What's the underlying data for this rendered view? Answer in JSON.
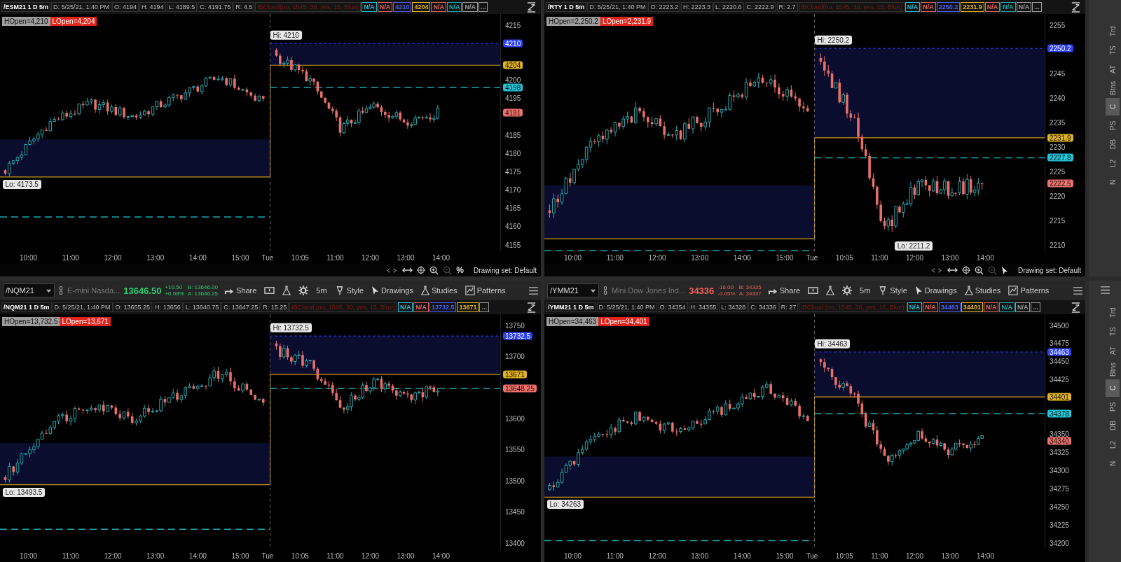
{
  "rows": [
    {
      "panels": [
        {
          "header": {
            "symbol": "/ESM21 1 D 5m",
            "fields": [
              "D: 5/25/21, 1:40 PM",
              "O: 4194",
              "H: 4194",
              "L: 4189.5",
              "C: 4191.75",
              "R: 4.5"
            ],
            "study": "IBCloud(no, 1545, 30, yes, 15, Blue)",
            "values": [
              {
                "text": "N/A",
                "color": "#22b8cf"
              },
              {
                "text": "N/A",
                "color": "#e0605a"
              },
              {
                "text": "4210",
                "color": "#4a5cff"
              },
              {
                "text": "4204",
                "color": "#e0b21d"
              },
              {
                "text": "N/A",
                "color": "#e0605a"
              },
              {
                "text": "N/A",
                "color": "#1aa6a6"
              },
              {
                "text": "N/A",
                "color": "#9a9a9a"
              },
              {
                "text": "...",
                "color": "#9a9a9a"
              }
            ]
          },
          "badges": [
            {
              "text": "HOpen=4,210",
              "color": "#9e9e9e"
            },
            {
              "text": "LOpen=4,204",
              "color": "#e0241b"
            }
          ],
          "y_ticks": [
            "4215",
            "4200",
            "4195",
            "4185",
            "4180",
            "4175",
            "4170",
            "4165",
            "4160",
            "4155"
          ],
          "price_tags": [
            {
              "text": "4210",
              "color": "#2b3ff5"
            },
            {
              "text": "4204",
              "color": "#e0b21d"
            },
            {
              "text": "4198",
              "color": "#1ec8dc"
            },
            {
              "text": "4191",
              "color": "#f0716b"
            }
          ],
          "sessions": [
            {
              "lo_label": "Lo: 4173.5",
              "x_ticks": [
                "10:00",
                "11:00",
                "12:00",
                "13:00",
                "14:00",
                "15:00"
              ]
            },
            {
              "hi_label": "Hi: 4210",
              "x_ticks": [
                "Tue",
                "10:05",
                "11:00",
                "12:00",
                "13:00",
                "14:00"
              ]
            }
          ],
          "footer": {
            "tool": {
              "kind": "text",
              "label": "%"
            },
            "drawing_set": "Drawing set: Default"
          }
        },
        {
          "header": {
            "symbol": "/RTY 1 D 5m",
            "fields": [
              "D: 5/25/21, 1:40 PM",
              "O: 2223.2",
              "H: 2223.3",
              "L: 2220.6",
              "C: 2222.9",
              "R: 2.7"
            ],
            "study": "IBCloud(no, 1545, 30, yes, 15, Blue)",
            "values": [
              {
                "text": "N/A",
                "color": "#22b8cf"
              },
              {
                "text": "N/A",
                "color": "#e0605a"
              },
              {
                "text": "2250.2",
                "color": "#4a5cff"
              },
              {
                "text": "2231.9",
                "color": "#e0b21d"
              },
              {
                "text": "N/A",
                "color": "#e0605a"
              },
              {
                "text": "N/A",
                "color": "#1aa6a6"
              },
              {
                "text": "N/A",
                "color": "#9a9a9a"
              },
              {
                "text": "...",
                "color": "#9a9a9a"
              }
            ]
          },
          "badges": [
            {
              "text": "HOpen=2,250.2",
              "color": "#9e9e9e"
            },
            {
              "text": "LOpen=2,231.9",
              "color": "#e0241b"
            }
          ],
          "y_ticks": [
            "2255",
            "2245",
            "2240",
            "2235",
            "2230",
            "2225",
            "2220",
            "2215",
            "2210"
          ],
          "price_tags": [
            {
              "text": "2250.2",
              "color": "#2b3ff5"
            },
            {
              "text": "2231.9",
              "color": "#e0b21d"
            },
            {
              "text": "2227.8",
              "color": "#1ec8dc"
            },
            {
              "text": "2222.5",
              "color": "#f0716b"
            }
          ],
          "sessions": [
            {
              "x_ticks": [
                "10:00",
                "11:00",
                "12:00",
                "13:00",
                "14:00",
                "15:00"
              ]
            },
            {
              "hi_label": "Hi: 2250.2",
              "lo_label": "Lo: 2211.2",
              "x_ticks": [
                "Tue",
                "10:05",
                "11:00",
                "12:00",
                "13:00",
                "14:00"
              ]
            }
          ],
          "footer": {
            "tool": {
              "kind": "pointer"
            },
            "drawing_set": "Drawing set: Default"
          }
        }
      ],
      "sidebar": {
        "tabs": [
          {
            "label": "Trd",
            "selected": false
          },
          {
            "label": "TS",
            "selected": false
          },
          {
            "label": "AT",
            "selected": false
          },
          {
            "label": "Btns",
            "selected": false
          },
          {
            "label": "C",
            "selected": true
          },
          {
            "label": "PS",
            "selected": false
          },
          {
            "label": "DB",
            "selected": false
          },
          {
            "label": "L2",
            "selected": false
          },
          {
            "label": "N",
            "selected": false
          }
        ]
      }
    },
    {
      "panels": [
        {
          "toolbar": {
            "symbol": "/NQM21",
            "description": "E-mini Nasda...",
            "price": "13646.50",
            "change": [
              "+10.50",
              "+0.08%"
            ],
            "quote": [
              "B: 13646.00",
              "A: 13646.25"
            ],
            "buttons": [
              {
                "kind": "share",
                "label": "Share"
              },
              {
                "kind": "alert"
              },
              {
                "kind": "flask"
              },
              {
                "kind": "gear"
              },
              {
                "kind": "text",
                "label": "5m"
              },
              {
                "kind": "style",
                "label": "Style"
              },
              {
                "kind": "pointer",
                "label": "Drawings"
              },
              {
                "kind": "flask",
                "label": "Studies"
              },
              {
                "kind": "pattern",
                "label": "Patterns"
              }
            ]
          },
          "header": {
            "symbol": "/NQM21 1 D 5m",
            "fields": [
              "D: 5/25/21, 1:40 PM",
              "O: 13655.25",
              "H: 13656",
              "L: 13640.75",
              "C: 13647.25",
              "R: 15.25"
            ],
            "study": "IBCloud (no, 1545, 30, yes, 15, Blue)",
            "values": [
              {
                "text": "N/A",
                "color": "#22b8cf"
              },
              {
                "text": "N/A",
                "color": "#e0605a"
              },
              {
                "text": "13732.5",
                "color": "#4a5cff"
              },
              {
                "text": "13671",
                "color": "#e0b21d"
              },
              {
                "text": "...",
                "color": "#9a9a9a"
              }
            ]
          },
          "badges": [
            {
              "text": "HOpen=13,732.5",
              "color": "#9e9e9e"
            },
            {
              "text": "LOpen=13,671",
              "color": "#e0241b"
            }
          ],
          "y_ticks": [
            "13750",
            "13700",
            "13600",
            "13550",
            "13500",
            "13450",
            "13400"
          ],
          "price_tags": [
            {
              "text": "13732.5",
              "color": "#2b3ff5"
            },
            {
              "text": "13671",
              "color": "#e0b21d"
            },
            {
              "text": "13648.25",
              "color": "#f0716b"
            }
          ],
          "sessions": [
            {
              "lo_label": "Lo: 13493.5",
              "x_ticks": [
                "10:00",
                "11:00",
                "12:00",
                "13:00",
                "14:00",
                "15:00"
              ]
            },
            {
              "hi_label": "Hi: 13732.5",
              "x_ticks": [
                "Tue",
                "10:05",
                "11:00",
                "12:00",
                "13:00",
                "14:00"
              ]
            }
          ]
        },
        {
          "toolbar": {
            "symbol": "/YMM21",
            "description": "Mini Dow Jones Ind...",
            "price": "34336",
            "change": [
              "-16.00",
              "-0.05%"
            ],
            "quote": [
              "B: 34335",
              "A: 34337"
            ],
            "buttons": [
              {
                "kind": "share",
                "label": "Share"
              },
              {
                "kind": "alert"
              },
              {
                "kind": "flask"
              },
              {
                "kind": "gear"
              },
              {
                "kind": "text",
                "label": "5m"
              },
              {
                "kind": "style",
                "label": "Style"
              },
              {
                "kind": "pointer",
                "label": "Drawings"
              },
              {
                "kind": "flask",
                "label": "Studies"
              },
              {
                "kind": "pattern",
                "label": "Patterns"
              }
            ]
          },
          "header": {
            "symbol": "/YMM21 1 D 5m",
            "fields": [
              "D: 5/25/21, 1:40 PM",
              "O: 34354",
              "H: 34355",
              "L: 34328",
              "C: 34336",
              "R: 27"
            ],
            "study": "IBCloud (no, 1545, 30, yes, 15, Blue)",
            "values": [
              {
                "text": "N/A",
                "color": "#22b8cf"
              },
              {
                "text": "N/A",
                "color": "#e0605a"
              },
              {
                "text": "34463",
                "color": "#4a5cff"
              },
              {
                "text": "34401",
                "color": "#e0b21d"
              },
              {
                "text": "N/A",
                "color": "#e0605a"
              },
              {
                "text": "N/A",
                "color": "#1aa6a6"
              },
              {
                "text": "N/A",
                "color": "#9a9a9a"
              },
              {
                "text": "...",
                "color": "#9a9a9a"
              }
            ]
          },
          "badges": [
            {
              "text": "HOpen=34,463",
              "color": "#9e9e9e"
            },
            {
              "text": "LOpen=34,401",
              "color": "#e0241b"
            }
          ],
          "y_ticks": [
            "34500",
            "34475",
            "34450",
            "34425",
            "34350",
            "34325",
            "34300",
            "34275",
            "34250",
            "34225",
            "34200"
          ],
          "price_tags": [
            {
              "text": "34463",
              "color": "#2b3ff5"
            },
            {
              "text": "34401",
              "color": "#e0b21d"
            },
            {
              "text": "34378",
              "color": "#1ec8dc"
            },
            {
              "text": "34340",
              "color": "#f0716b"
            }
          ],
          "sessions": [
            {
              "lo_label": "Lo: 34263",
              "x_ticks": [
                "10:00",
                "11:00",
                "12:00",
                "13:00",
                "14:00",
                "15:00"
              ]
            },
            {
              "hi_label": "Hi: 34463",
              "x_ticks": [
                "Tue",
                "10:05",
                "11:00",
                "12:00",
                "13:00",
                "14:00"
              ]
            }
          ]
        }
      ],
      "sidebar": {
        "menu": true,
        "tabs": [
          {
            "label": "Trd",
            "selected": false
          },
          {
            "label": "TS",
            "selected": false
          },
          {
            "label": "AT",
            "selected": false
          },
          {
            "label": "Btns",
            "selected": false
          },
          {
            "label": "C",
            "selected": true
          },
          {
            "label": "PS",
            "selected": false
          },
          {
            "label": "DB",
            "selected": false
          },
          {
            "label": "L2",
            "selected": false
          },
          {
            "label": "N",
            "selected": false
          }
        ]
      }
    }
  ]
}
